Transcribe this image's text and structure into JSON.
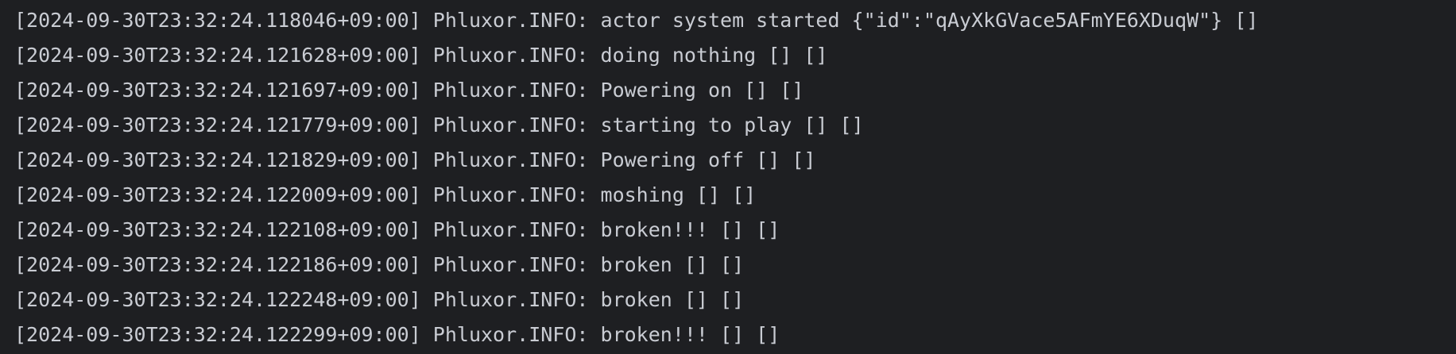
{
  "console": {
    "lines": [
      "[2024-09-30T23:32:24.118046+09:00] Phluxor.INFO: actor system started {\"id\":\"qAyXkGVace5AFmYE6XDuqW\"} []",
      "[2024-09-30T23:32:24.121628+09:00] Phluxor.INFO: doing nothing [] []",
      "[2024-09-30T23:32:24.121697+09:00] Phluxor.INFO: Powering on [] []",
      "[2024-09-30T23:32:24.121779+09:00] Phluxor.INFO: starting to play [] []",
      "[2024-09-30T23:32:24.121829+09:00] Phluxor.INFO: Powering off [] []",
      "[2024-09-30T23:32:24.122009+09:00] Phluxor.INFO: moshing [] []",
      "[2024-09-30T23:32:24.122108+09:00] Phluxor.INFO: broken!!! [] []",
      "[2024-09-30T23:32:24.122186+09:00] Phluxor.INFO: broken [] []",
      "[2024-09-30T23:32:24.122248+09:00] Phluxor.INFO: broken [] []",
      "[2024-09-30T23:32:24.122299+09:00] Phluxor.INFO: broken!!! [] []"
    ]
  },
  "colors": {
    "background": "#1e1f22",
    "text": "#c9ccd3"
  }
}
